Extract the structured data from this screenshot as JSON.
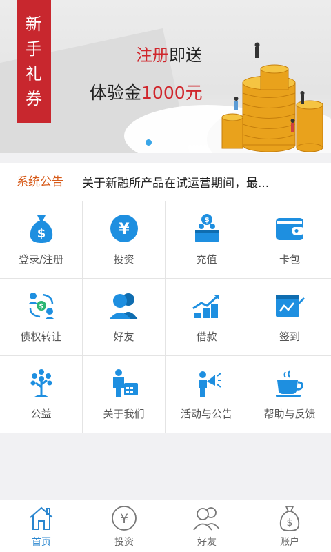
{
  "banner": {
    "tag_chars": [
      "新",
      "手",
      "礼",
      "券"
    ],
    "promo_line1_red": "注册",
    "promo_line1_rest": "即送",
    "promo_line2_prefix": "体验金",
    "promo_line2_amount": "1000元"
  },
  "notice": {
    "tag": "系统公告",
    "text": "关于新融所产品在试运营期间，最..."
  },
  "grid": [
    {
      "label": "登录/注册",
      "icon": "money-bag-icon"
    },
    {
      "label": "投资",
      "icon": "yen-circle-icon"
    },
    {
      "label": "充值",
      "icon": "recharge-icon"
    },
    {
      "label": "卡包",
      "icon": "wallet-icon"
    },
    {
      "label": "债权转让",
      "icon": "transfer-icon"
    },
    {
      "label": "好友",
      "icon": "friends-icon"
    },
    {
      "label": "借款",
      "icon": "growth-coins-icon"
    },
    {
      "label": "签到",
      "icon": "sign-in-icon"
    },
    {
      "label": "公益",
      "icon": "tree-icon"
    },
    {
      "label": "关于我们",
      "icon": "about-us-icon"
    },
    {
      "label": "活动与公告",
      "icon": "megaphone-icon"
    },
    {
      "label": "帮助与反馈",
      "icon": "coffee-cup-icon"
    }
  ],
  "tabbar": [
    {
      "label": "首页",
      "icon": "home-icon",
      "active": true
    },
    {
      "label": "投资",
      "icon": "yen-circle-icon",
      "active": false
    },
    {
      "label": "好友",
      "icon": "friends-icon",
      "active": false
    },
    {
      "label": "账户",
      "icon": "money-bag-icon",
      "active": false
    }
  ],
  "colors": {
    "accent_blue": "#1e90e0",
    "brand_red": "#c8272e",
    "notice_orange": "#d75b1a"
  }
}
